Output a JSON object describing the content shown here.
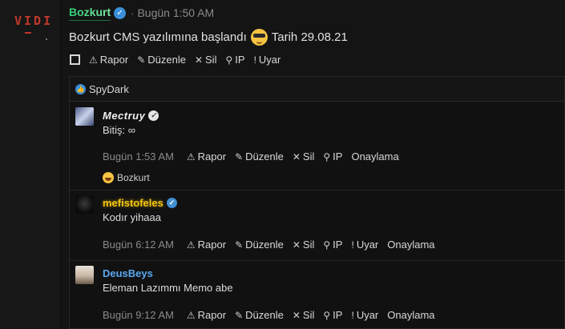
{
  "logo": {
    "text": "VIDI"
  },
  "post": {
    "author": "Bozkurt",
    "separator": "·",
    "time": "Bugün 1:50 AM",
    "text_before": "Bozkurt CMS yazılımına başlandı",
    "text_after": "Tarih 29.08.21",
    "actions": {
      "report": "Rapor",
      "edit": "Düzenle",
      "delete": "Sil",
      "ip": "IP",
      "warn": "Uyar"
    }
  },
  "likes": {
    "names": "SpyDark"
  },
  "comments": [
    {
      "author": "Mectruy",
      "text": "Bitiş: ∞",
      "time": "Bugün 1:53 AM",
      "actions": {
        "report": "Rapor",
        "edit": "Düzenle",
        "delete": "Sil",
        "ip": "IP",
        "approve": "Onaylama"
      },
      "reaction": "Bozkurt"
    },
    {
      "author": "mefistofeles",
      "text": "Kodır yihaaa",
      "time": "Bugün 6:12 AM",
      "actions": {
        "report": "Rapor",
        "edit": "Düzenle",
        "delete": "Sil",
        "ip": "IP",
        "warn": "Uyar",
        "approve": "Onaylama"
      }
    },
    {
      "author": "DeusBeys",
      "text": "Eleman Lazımmı Memo abe",
      "time": "Bugün 9:12 AM",
      "actions": {
        "report": "Rapor",
        "edit": "Düzenle",
        "delete": "Sil",
        "ip": "IP",
        "warn": "Uyar",
        "approve": "Onaylama"
      }
    }
  ],
  "colors": {
    "accent_blue": "#3b8fd9",
    "author_green": "#2ecc71",
    "author_gold": "#f1c40f",
    "link_blue": "#5aa9f0",
    "logo_red": "#c0392b"
  }
}
